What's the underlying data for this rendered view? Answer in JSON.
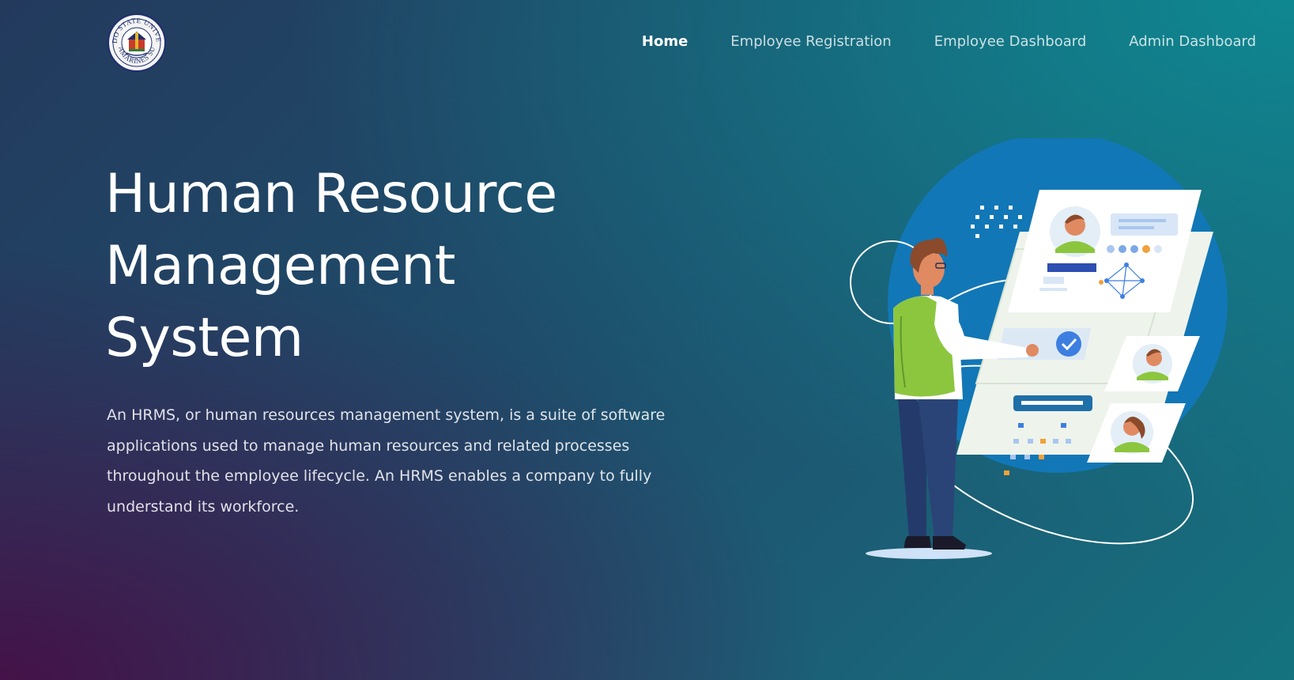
{
  "logo": {
    "icon": "university-seal-icon",
    "text_top": "PARTIDO STATE UNIVERSITY",
    "text_bottom": "CAMARINES SUR"
  },
  "nav": {
    "items": [
      {
        "label": "Home",
        "active": true
      },
      {
        "label": "Employee Registration",
        "active": false
      },
      {
        "label": "Employee Dashboard",
        "active": false
      },
      {
        "label": "Admin Dashboard",
        "active": false
      }
    ]
  },
  "hero": {
    "title_lines": [
      "Human Resource",
      "Management",
      "System"
    ],
    "description": "An HRMS, or human resources management system, is a suite of software applications used to manage human resources and related processes throughout the employee lifecycle. An HRMS enables a company to fully understand its workforce."
  },
  "illustration": {
    "icon": "hr-dashboard-illustration"
  },
  "colors": {
    "accent_blue": "#1277b6",
    "vest_green": "#8cc63f",
    "hair_brown": "#8b4a2b",
    "check_blue": "#3d7fe0",
    "bar_navy": "#2d4fb2"
  }
}
